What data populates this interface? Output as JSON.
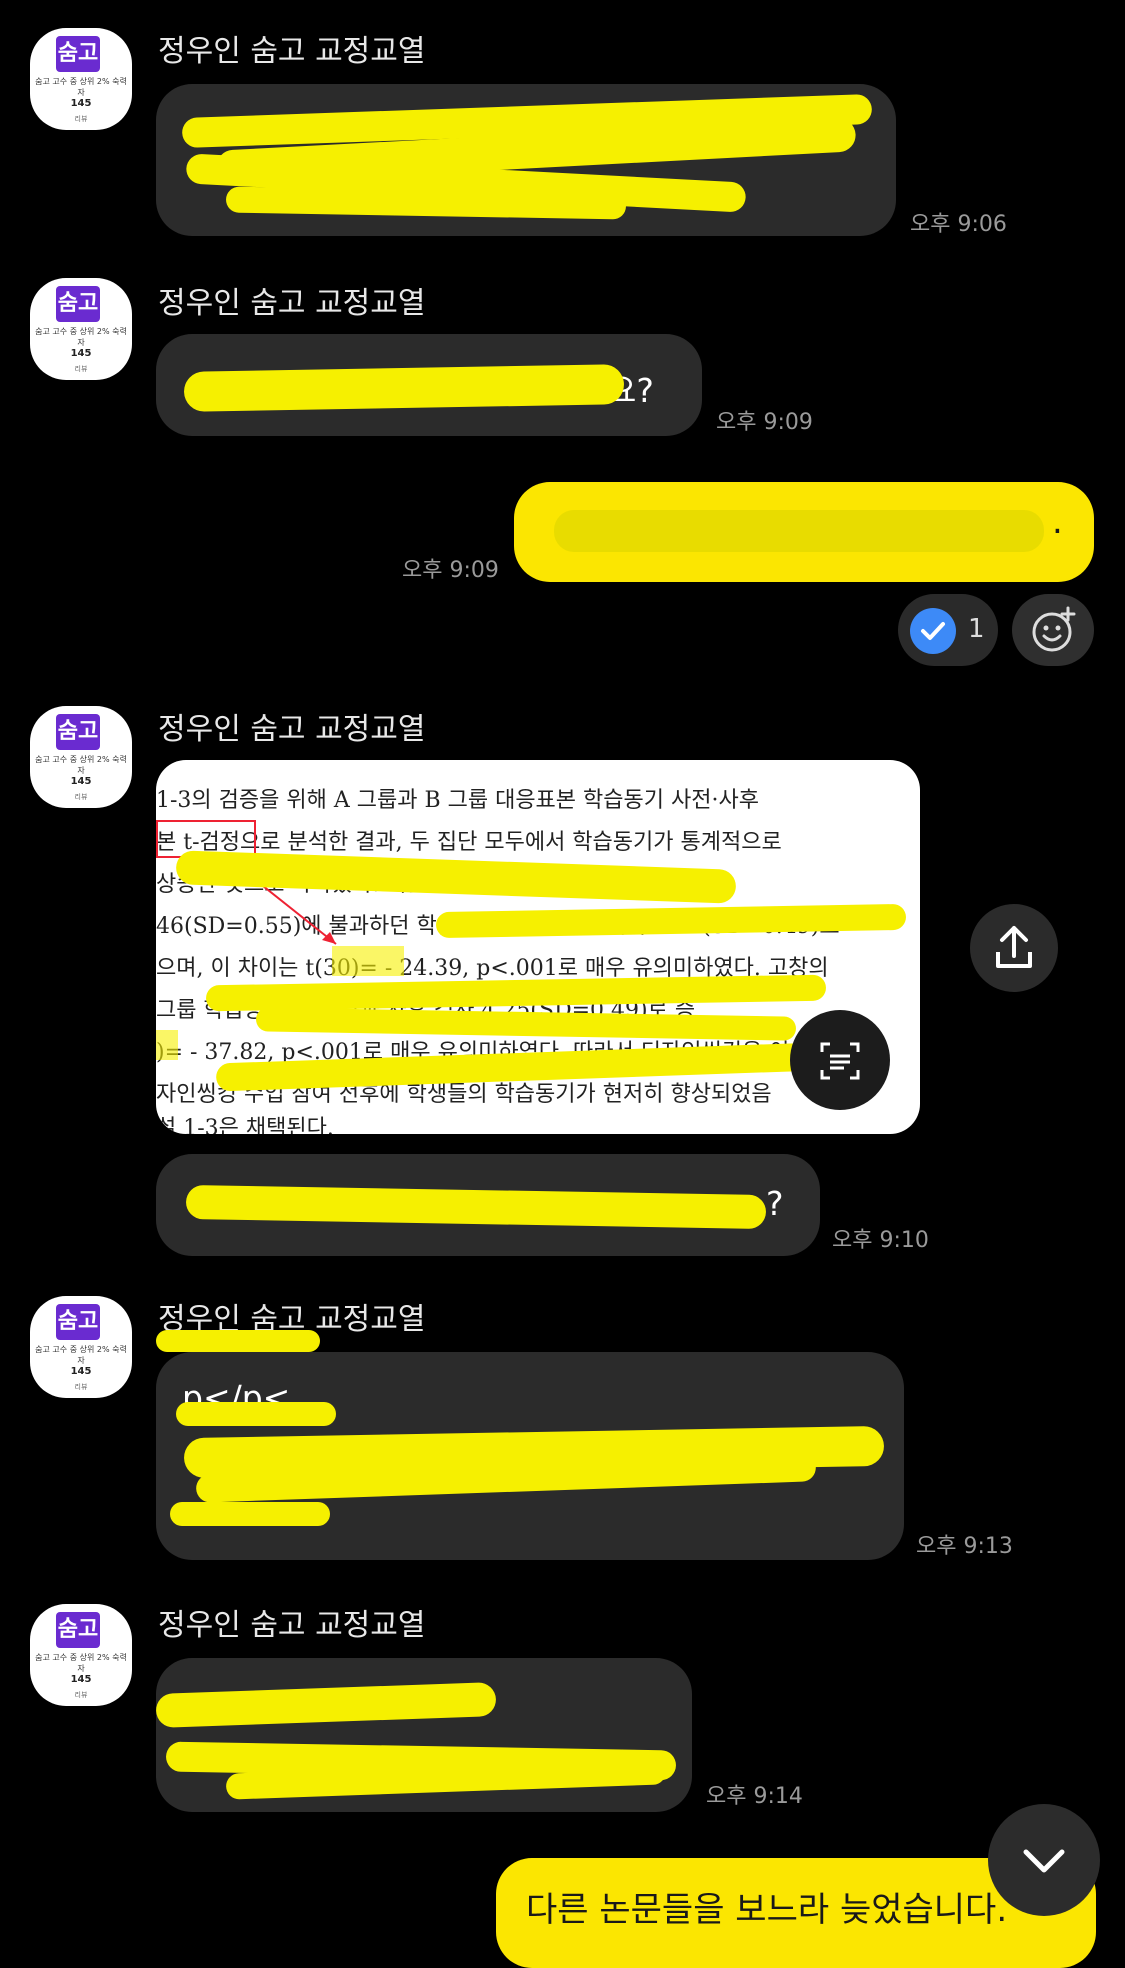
{
  "chat": {
    "sender_name": "정우인 숨고 교정교열",
    "avatar": {
      "logo": "숨고",
      "mini_text": "숨고 고수 중 상위 2% 숙력자",
      "count": "145",
      "sub": "리뷰"
    },
    "messages": [
      {
        "id": "m1",
        "direction": "incoming",
        "time": "오후 9:06"
      },
      {
        "id": "m2",
        "direction": "incoming",
        "visible_text": "요?",
        "time": "오후 9:09"
      },
      {
        "id": "m3",
        "direction": "outgoing",
        "visible_text": ".",
        "time": "오후 9:09",
        "reaction_count": "1"
      },
      {
        "id": "m4",
        "direction": "incoming",
        "type": "image",
        "image_lines": [
          "1-3의 검증을 위해 A 그룹과 B 그룹 대응표본 학습동기 사전·사후",
          "본 t-검정으로 분석한 결과, 두 집단 모두에서 학습동기가 통계적으로",
          "상승한 것으로 나타났다. 이를 살펴보면 A 그룹은 사전검",
          "46(SD=0.55)에 불과하던 학습동기가 사후검사에서 4.25(SD=0.49)로",
          "으며, 이 차이는 t(30)= - 24.39, p<.001로 매우 유의미하였다. 고창의",
          "그룹 학습동기 검사 결과 사후 검사 4.25(SD=0.49)로 증",
          ")= - 37.82, p<.001로 매우 유의미하였다. 따라서 디자인씽킹은 이",
          "자인씽킹 수업 참여 전후에 학생들의 학습동기가 현저히 향상되었음",
          "설 1-3은 채택된다."
        ]
      },
      {
        "id": "m5",
        "direction": "incoming",
        "visible_text": "?",
        "time": "오후 9:10"
      },
      {
        "id": "m6",
        "direction": "incoming",
        "visible_text": "p</p<",
        "time": "오후 9:13"
      },
      {
        "id": "m7",
        "direction": "incoming",
        "time": "오후 9:14"
      },
      {
        "id": "m8",
        "direction": "outgoing",
        "visible_text": "다른 논문들을 보느라 늦었습니다."
      }
    ]
  },
  "colors": {
    "outgoing_bubble": "#fbe601",
    "incoming_bubble": "#2b2b2b",
    "background": "#000000",
    "check_badge": "#3d8af7"
  },
  "icons": {
    "reaction_check": "check-circle-icon",
    "add_emoji": "emoji-add-icon",
    "share": "share-icon",
    "text_scan": "text-scan-icon",
    "scroll_down": "chevron-down-icon"
  }
}
